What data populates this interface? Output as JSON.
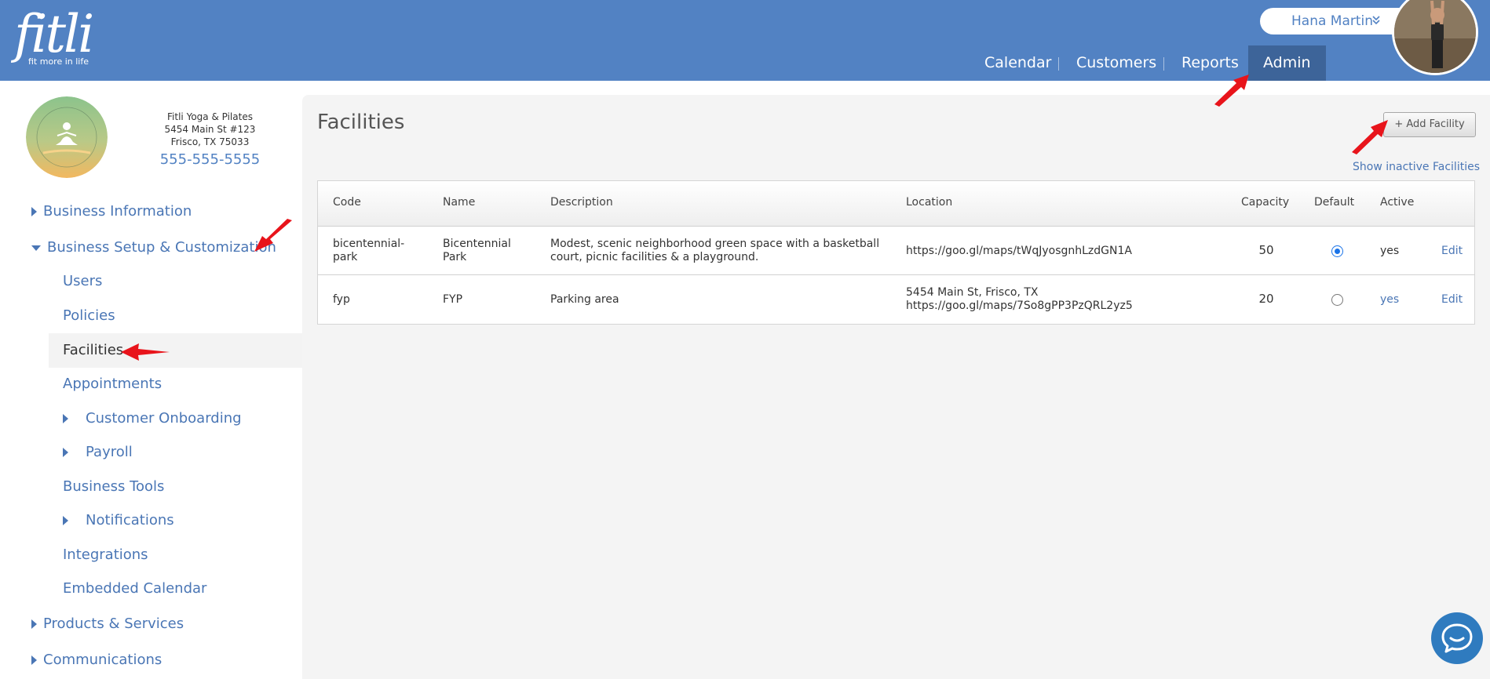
{
  "header": {
    "logo_text": "fitli",
    "logo_tagline": "fit more in life",
    "user_name": "Hana Martin",
    "nav": [
      {
        "label": "Calendar"
      },
      {
        "label": "Customers"
      },
      {
        "label": "Reports"
      },
      {
        "label": "Admin",
        "active": true
      }
    ]
  },
  "business": {
    "name": "Fitli Yoga & Pilates",
    "address1": "5454 Main St #123",
    "address2": "Frisco, TX 75033",
    "phone": "555-555-5555"
  },
  "sidebar": {
    "items": [
      {
        "label": "Business Information"
      },
      {
        "label": "Business Setup & Customization"
      },
      {
        "label": "Users"
      },
      {
        "label": "Policies"
      },
      {
        "label": "Facilities",
        "selected": true
      },
      {
        "label": "Appointments"
      },
      {
        "label": "Customer Onboarding"
      },
      {
        "label": "Payroll"
      },
      {
        "label": "Business Tools"
      },
      {
        "label": "Notifications"
      },
      {
        "label": "Integrations"
      },
      {
        "label": "Embedded Calendar"
      },
      {
        "label": "Products & Services"
      },
      {
        "label": "Communications"
      }
    ]
  },
  "main": {
    "title": "Facilities",
    "add_button": "+ Add Facility",
    "show_inactive": "Show inactive Facilities",
    "columns": [
      "Code",
      "Name",
      "Description",
      "Location",
      "Capacity",
      "Default",
      "Active"
    ],
    "rows": [
      {
        "code_line1": "bicentennial-",
        "code_line2": "park",
        "name_line1": "Bicentennial",
        "name_line2": "Park",
        "desc_line1": "Modest, scenic neighborhood green space with a basketball",
        "desc_line2": "court, picnic facilities & a playground.",
        "location_line1": "https://goo.gl/maps/tWqJyosgnhLzdGN1A",
        "location_line2": "",
        "capacity": "50",
        "default": true,
        "active": "yes",
        "edit": "Edit"
      },
      {
        "code_line1": "fyp",
        "code_line2": "",
        "name_line1": "FYP",
        "name_line2": "",
        "desc_line1": "Parking area",
        "desc_line2": "",
        "location_line1": "5454 Main St, Frisco, TX",
        "location_line2": "https://goo.gl/maps/7So8gPP3PzQRL2yz5",
        "capacity": "20",
        "default": false,
        "active": "yes",
        "edit": "Edit"
      }
    ]
  },
  "colors": {
    "header_bg": "#5282c3",
    "nav_active_bg": "#3d6499",
    "link": "#4a76b5",
    "annotation_arrow": "#e8141b"
  }
}
